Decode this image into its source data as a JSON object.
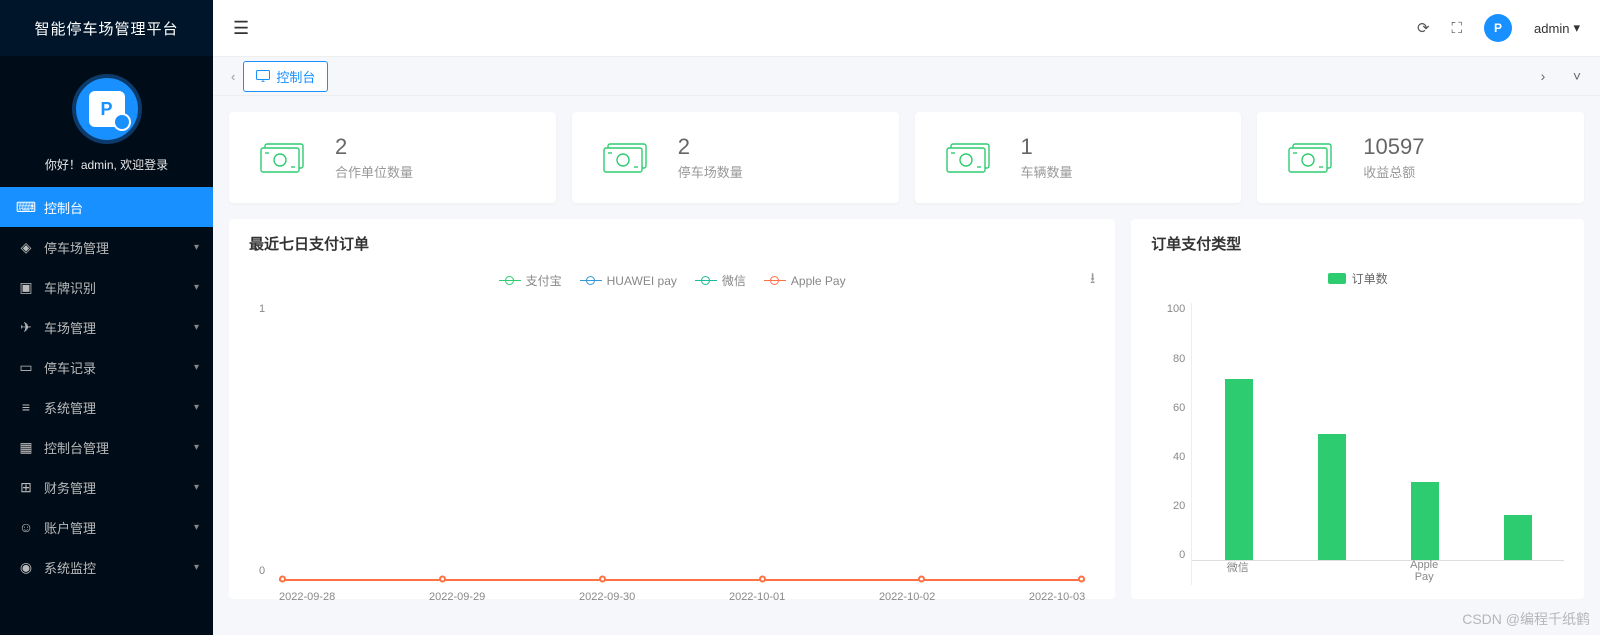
{
  "app": {
    "title": "智能停车场管理平台"
  },
  "user": {
    "welcome": "你好！admin, 欢迎登录",
    "name": "admin",
    "avatar_letter": "P"
  },
  "sidebar": {
    "items": [
      {
        "label": "控制台",
        "icon": "⌨",
        "active": true,
        "has_children": false
      },
      {
        "label": "停车场管理",
        "icon": "◈",
        "active": false,
        "has_children": true
      },
      {
        "label": "车牌识别",
        "icon": "▣",
        "active": false,
        "has_children": true
      },
      {
        "label": "车场管理",
        "icon": "✈",
        "active": false,
        "has_children": true
      },
      {
        "label": "停车记录",
        "icon": "▭",
        "active": false,
        "has_children": true
      },
      {
        "label": "系统管理",
        "icon": "≡",
        "active": false,
        "has_children": true
      },
      {
        "label": "控制台管理",
        "icon": "▦",
        "active": false,
        "has_children": true
      },
      {
        "label": "财务管理",
        "icon": "⊞",
        "active": false,
        "has_children": true
      },
      {
        "label": "账户管理",
        "icon": "☺",
        "active": false,
        "has_children": true
      },
      {
        "label": "系统监控",
        "icon": "◉",
        "active": false,
        "has_children": true
      }
    ]
  },
  "tabs": {
    "active": "控制台"
  },
  "stats": [
    {
      "value": "2",
      "label": "合作单位数量"
    },
    {
      "value": "2",
      "label": "停车场数量"
    },
    {
      "value": "1",
      "label": "车辆数量"
    },
    {
      "value": "10597",
      "label": "收益总额"
    }
  ],
  "line_chart": {
    "title": "最近七日支付订单",
    "legend": [
      {
        "name": "支付宝",
        "color": "#2ecc71"
      },
      {
        "name": "HUAWEI pay",
        "color": "#3498db"
      },
      {
        "name": "微信",
        "color": "#1abc9c"
      },
      {
        "name": "Apple Pay",
        "color": "#ff7043"
      }
    ]
  },
  "bar_chart": {
    "title": "订单支付类型",
    "legend_label": "订单数"
  },
  "chart_data": [
    {
      "type": "line",
      "title": "最近七日支付订单",
      "x": [
        "2022-09-28",
        "2022-09-29",
        "2022-09-30",
        "2022-10-01",
        "2022-10-02",
        "2022-10-03"
      ],
      "series": [
        {
          "name": "支付宝",
          "values": [
            0,
            0,
            0,
            0,
            0,
            0
          ]
        },
        {
          "name": "HUAWEI pay",
          "values": [
            0,
            0,
            0,
            0,
            0,
            0
          ]
        },
        {
          "name": "微信",
          "values": [
            0,
            0,
            0,
            0,
            0,
            0
          ]
        },
        {
          "name": "Apple Pay",
          "values": [
            0,
            0,
            0,
            0,
            0,
            0
          ]
        }
      ],
      "ylim": [
        0,
        1
      ],
      "yticks": [
        0,
        1
      ],
      "xlabel": "",
      "ylabel": ""
    },
    {
      "type": "bar",
      "title": "订单支付类型",
      "categories": [
        "微信",
        "",
        "Apple Pay",
        ""
      ],
      "values": [
        83,
        58,
        36,
        21
      ],
      "ylim": [
        0,
        100
      ],
      "yticks": [
        0,
        20,
        40,
        60,
        80,
        100
      ],
      "legend": [
        "订单数"
      ],
      "xlabel": "",
      "ylabel": ""
    }
  ],
  "watermark": "CSDN @编程千纸鹤"
}
